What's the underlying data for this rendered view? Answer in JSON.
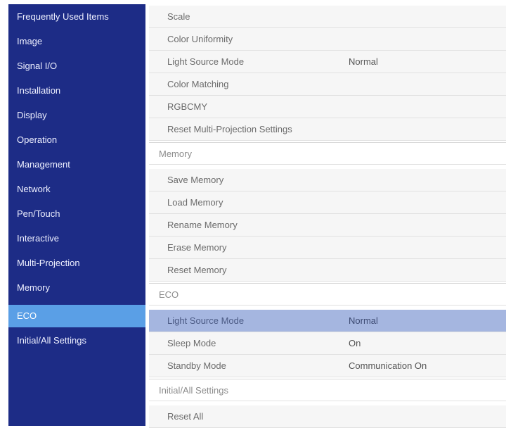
{
  "sidebar": {
    "items": [
      {
        "label": "Frequently Used Items"
      },
      {
        "label": "Image"
      },
      {
        "label": "Signal I/O"
      },
      {
        "label": "Installation"
      },
      {
        "label": "Display"
      },
      {
        "label": "Operation"
      },
      {
        "label": "Management"
      },
      {
        "label": "Network"
      },
      {
        "label": "Pen/Touch"
      },
      {
        "label": "Interactive"
      },
      {
        "label": "Multi-Projection"
      },
      {
        "label": "Memory"
      },
      {
        "label": "ECO"
      },
      {
        "label": "Initial/All Settings"
      }
    ],
    "selected": "ECO"
  },
  "panel": {
    "multi_projection": {
      "scale": "Scale",
      "color_uniformity": "Color Uniformity",
      "light_source_mode": {
        "label": "Light Source Mode",
        "value": "Normal"
      },
      "color_matching": "Color Matching",
      "rgbcmy": "RGBCMY",
      "reset_multi_projection": "Reset Multi-Projection Settings"
    },
    "memory": {
      "header": "Memory",
      "save": "Save Memory",
      "load": "Load Memory",
      "rename": "Rename Memory",
      "erase": "Erase Memory",
      "reset": "Reset Memory"
    },
    "eco": {
      "header": "ECO",
      "light_source_mode": {
        "label": "Light Source Mode",
        "value": "Normal"
      },
      "sleep_mode": {
        "label": "Sleep Mode",
        "value": "On"
      },
      "standby_mode": {
        "label": "Standby Mode",
        "value": "Communication On"
      }
    },
    "initial": {
      "header": "Initial/All Settings",
      "reset_all": "Reset All"
    }
  }
}
